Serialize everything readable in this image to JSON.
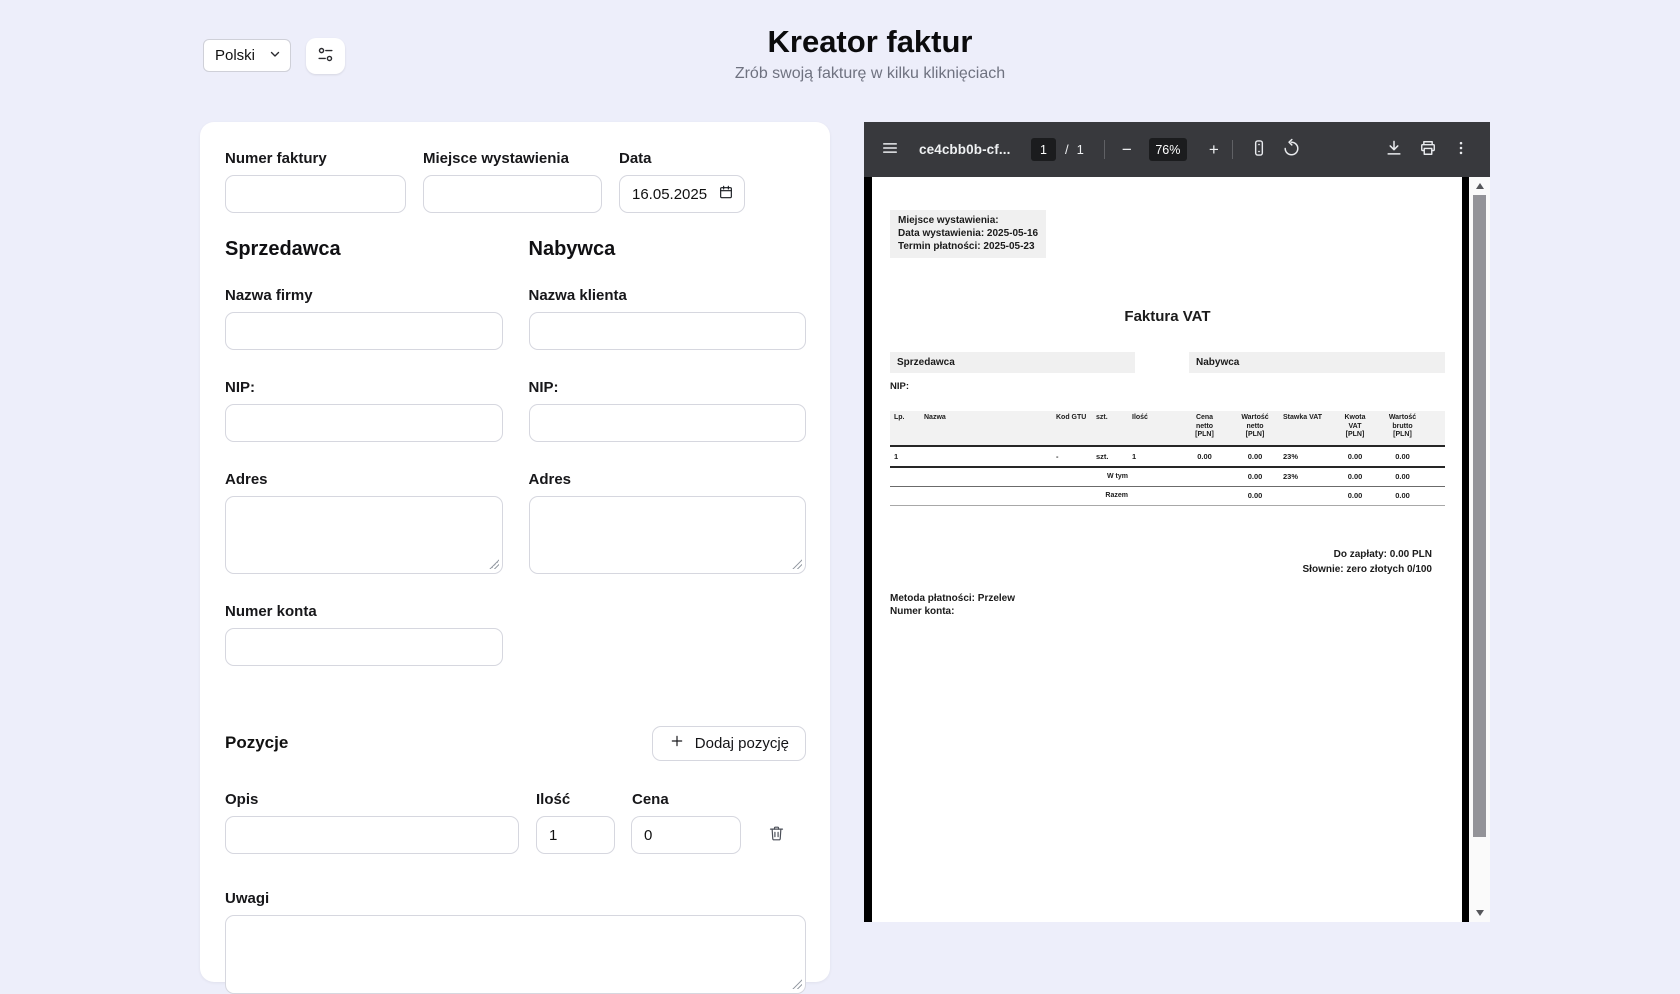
{
  "page": {
    "title": "Kreator faktur",
    "subtitle": "Zrób swoją fakturę w kilku kliknięciach"
  },
  "topbar": {
    "language": "Polski",
    "settings_icon": "settings-sliders"
  },
  "form": {
    "row1": {
      "invoice_number_label": "Numer faktury",
      "issue_place_label": "Miejsce wystawienia",
      "date_label": "Data",
      "date_value": "16.05.2025"
    },
    "seller": {
      "heading": "Sprzedawca",
      "company_label": "Nazwa firmy",
      "nip_label": "NIP:",
      "address_label": "Adres",
      "account_label": "Numer konta"
    },
    "buyer": {
      "heading": "Nabywca",
      "client_label": "Nazwa klienta",
      "nip_label": "NIP:",
      "address_label": "Adres"
    },
    "items": {
      "heading": "Pozycje",
      "add_button_label": "Dodaj pozycję",
      "desc_label": "Opis",
      "qty_label": "Ilość",
      "price_label": "Cena",
      "row": {
        "qty": "1",
        "price": "0"
      }
    },
    "notes_label": "Uwagi"
  },
  "pdf_viewer": {
    "toolbar": {
      "filename": "ce4cbb0b-cf...",
      "page_current": "1",
      "page_separator": "/",
      "page_total": "1",
      "zoom_out": "−",
      "zoom_level": "76%",
      "zoom_in": "+"
    },
    "document": {
      "meta_lines": [
        "Miejsce wystawienia:",
        "Data wystawienia: 2025-05-16",
        "Termin płatności: 2025-05-23"
      ],
      "title": "Faktura VAT",
      "seller_header": "Sprzedawca",
      "buyer_header": "Nabywca",
      "nip_label": "NIP:",
      "table": {
        "headers": [
          "Lp.",
          "Nazwa",
          "Kod GTU",
          "szt.",
          "Ilość",
          "Cena\nnetto\n[PLN]",
          "Wartość\nnetto\n[PLN]",
          "Stawka VAT",
          "Kwota\nVAT\n[PLN]",
          "Wartość\nbrutto\n[PLN]"
        ],
        "row": [
          "1",
          "",
          "-",
          "szt.",
          "1",
          "0.00",
          "0.00",
          "23%",
          "0.00",
          "0.00"
        ],
        "subtotal_row": {
          "label": "W tym",
          "net": "0.00",
          "vat_rate": "23%",
          "vat_amount": "0.00",
          "gross": "0.00"
        },
        "total_row": {
          "label": "Razem",
          "net": "0.00",
          "vat_amount": "0.00",
          "gross": "0.00"
        }
      },
      "amount_due": "Do zapłaty: 0.00 PLN",
      "amount_in_words": "Słownie: zero złotych 0/100",
      "payment_method": "Metoda płatności: Przelew",
      "account_number_label": "Numer konta:"
    }
  },
  "colors": {
    "background": "#edeefa",
    "card": "#ffffff",
    "input_border": "#d6d7df",
    "toolbar": "#38393d",
    "toolbar_box": "#1b1c1e",
    "pdf_frame": "#000000",
    "doc_gray": "#f0f0f0"
  }
}
